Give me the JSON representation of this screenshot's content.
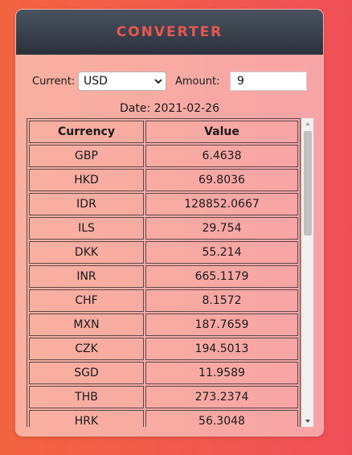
{
  "header": {
    "title": "CONVERTER"
  },
  "controls": {
    "current_label": "Current:",
    "current_value": "USD",
    "amount_label": "Amount:",
    "amount_value": "9"
  },
  "date_text": "Date: 2021-02-26",
  "table": {
    "headers": [
      "Currency",
      "Value"
    ],
    "rows": [
      [
        "GBP",
        "6.4638"
      ],
      [
        "HKD",
        "69.8036"
      ],
      [
        "IDR",
        "128852.0667"
      ],
      [
        "ILS",
        "29.754"
      ],
      [
        "DKK",
        "55.214"
      ],
      [
        "INR",
        "665.1179"
      ],
      [
        "CHF",
        "8.1572"
      ],
      [
        "MXN",
        "187.7659"
      ],
      [
        "CZK",
        "194.5013"
      ],
      [
        "SGD",
        "11.9589"
      ],
      [
        "THB",
        "273.2374"
      ],
      [
        "HRK",
        "56.3048"
      ]
    ]
  },
  "icons": {
    "select_arrow": "chevron-down-icon",
    "scroll_up": "scroll-up-arrow-icon",
    "scroll_down": "scroll-down-arrow-icon"
  }
}
